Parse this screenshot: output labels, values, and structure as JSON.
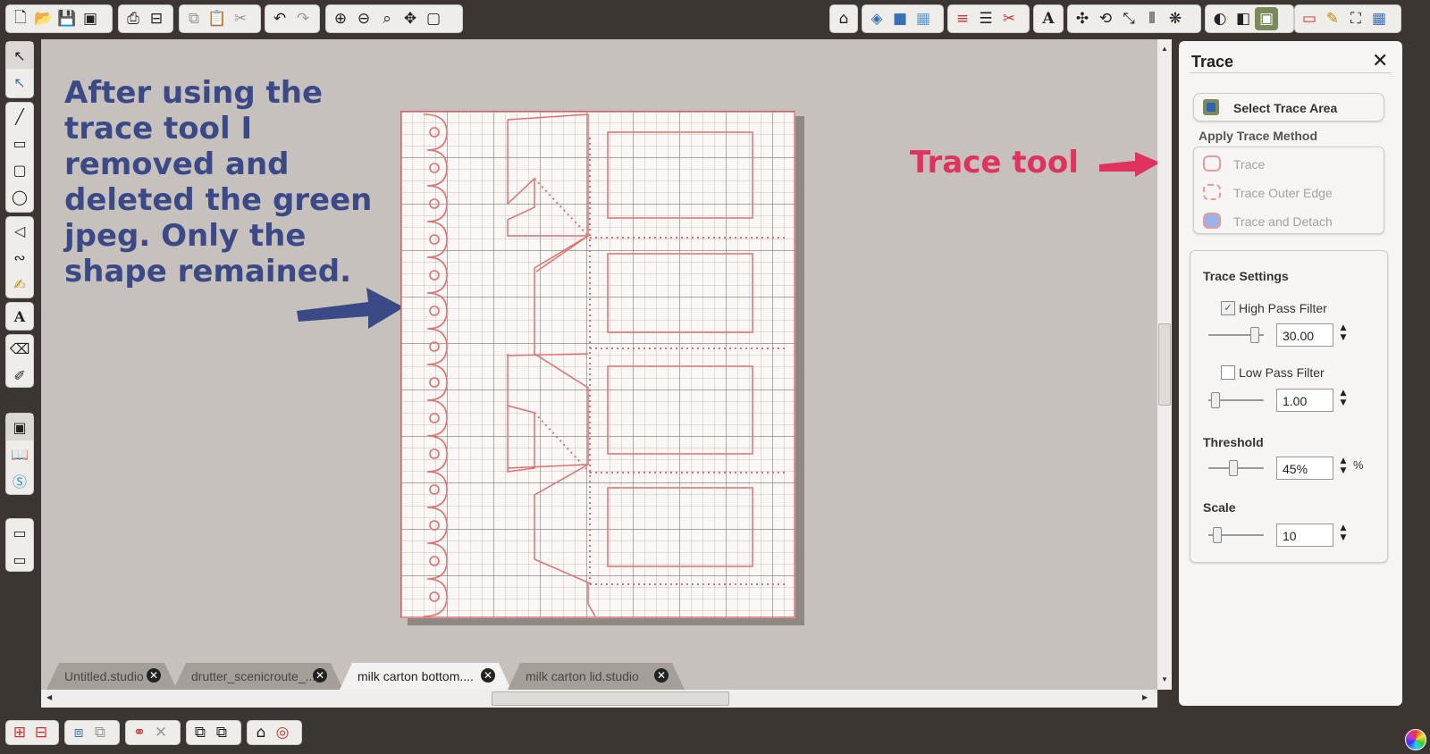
{
  "toolbar": {
    "icons": [
      "new-icon",
      "open-icon",
      "save-icon",
      "save-library-icon",
      "print-icon",
      "cutter-icon",
      "copy-icon",
      "paste-icon",
      "cut-icon",
      "undo-icon",
      "redo-icon",
      "zoom-in-icon",
      "zoom-out-icon",
      "zoom-selected-icon",
      "pan-icon",
      "fit-page-icon"
    ]
  },
  "annotations": {
    "left_note_lines": [
      "After using the",
      "trace tool I",
      "removed and",
      "deleted the green",
      "jpeg.  Only the",
      "shape remained."
    ],
    "right_note": "Trace tool",
    "left_note_color": "#3b4a86",
    "right_note_color": "#e0325e"
  },
  "tabs": [
    {
      "label": "Untitled.studio",
      "active": false
    },
    {
      "label": "drutter_scenicroute_...",
      "active": false
    },
    {
      "label": "milk carton bottom....",
      "active": true
    },
    {
      "label": "milk carton lid.studio",
      "active": false
    }
  ],
  "tab_close_glyph": "✕",
  "trace_panel": {
    "title": "Trace",
    "close_glyph": "✕",
    "select_area_label": "Select Trace Area",
    "apply_method_label": "Apply Trace Method",
    "methods": [
      "Trace",
      "Trace Outer Edge",
      "Trace and Detach"
    ],
    "settings_title": "Trace Settings",
    "high_pass": {
      "label": "High Pass Filter",
      "checked": true,
      "value": "30.00",
      "level": 0.9
    },
    "low_pass": {
      "label": "Low Pass Filter",
      "checked": false,
      "value": "1.00",
      "level": 0.05
    },
    "threshold": {
      "label": "Threshold",
      "value": "45%",
      "unit": "%",
      "level": 0.45
    },
    "scale": {
      "label": "Scale",
      "value": "10",
      "level": 0.1
    }
  },
  "colors": {
    "cut_line": "#e07070",
    "grid": "#8a8a8a",
    "selection": "#7b8a5a"
  }
}
